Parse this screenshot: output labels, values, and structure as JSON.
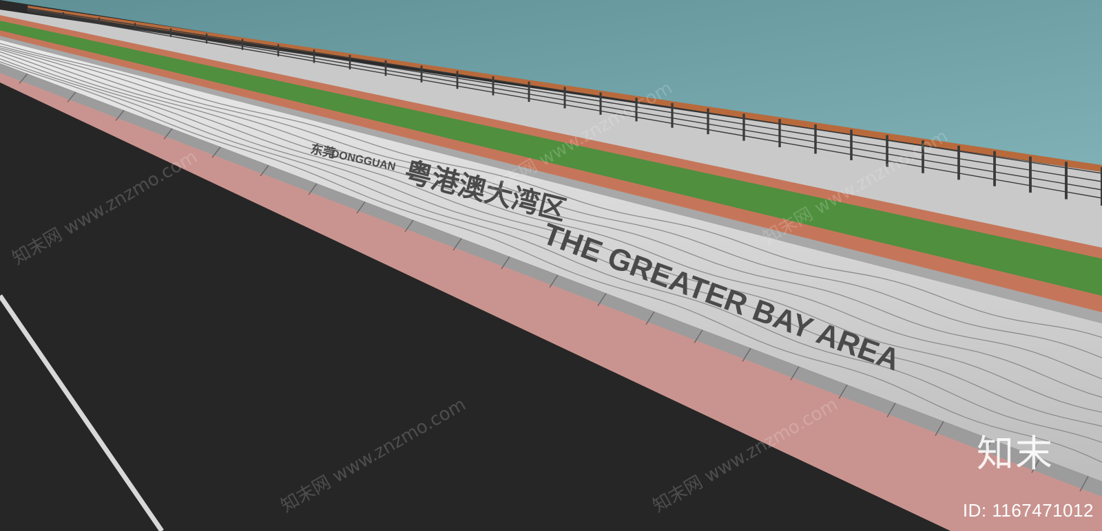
{
  "wall_signage": {
    "chinese_title": "粤港澳大湾区",
    "english_title": "THE GREATER BAY AREA",
    "city_name_cn": "东莞",
    "city_name_en": "DONGGUAN"
  },
  "watermarks": {
    "logo_text": "知末",
    "image_id": "ID: 1167471012",
    "tile_text": "知末网 www.znzmo.com"
  },
  "colors": {
    "water": "#6e9da3",
    "road": "#262626",
    "pink_curb": "#c99490",
    "grass": "#4f8f3e",
    "red_path": "#c5765a",
    "wall": "#d9d9d9",
    "wave_line": "#8c8c8c",
    "railing": "#3a3a3a"
  }
}
